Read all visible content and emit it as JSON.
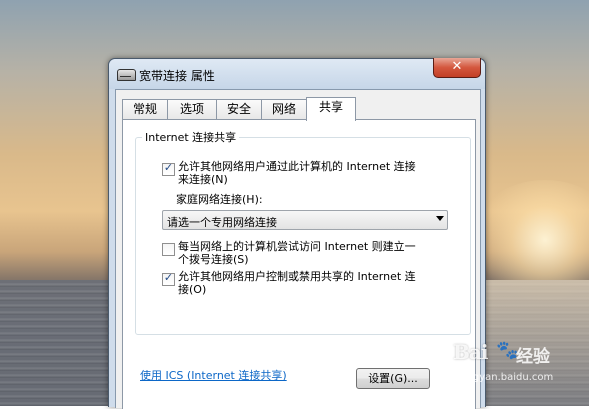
{
  "window": {
    "title": "宽带连接 属性",
    "close_label": "✕"
  },
  "tabs": [
    {
      "label": "常规",
      "active": false
    },
    {
      "label": "选项",
      "active": false
    },
    {
      "label": "安全",
      "active": false
    },
    {
      "label": "网络",
      "active": false
    },
    {
      "label": "共享",
      "active": true
    }
  ],
  "sharing": {
    "group_title": "Internet 连接共享",
    "allow_connect": {
      "checked": true,
      "line1": "允许其他网络用户通过此计算机的 Internet 连接",
      "line2": "来连接(N)"
    },
    "home_network_label": "家庭网络连接(H):",
    "home_network_select": "请选一个专用网络连接",
    "dial_on_demand": {
      "checked": false,
      "line1": "每当网络上的计算机尝试访问 Internet 则建立一",
      "line2": "个拨号连接(S)"
    },
    "allow_control": {
      "checked": true,
      "line1": "允许其他网络用户控制或禁用共享的 Internet 连",
      "line2": "接(O)"
    },
    "ics_link": "使用 ICS (Internet 连接共享)",
    "settings_button": "设置(G)..."
  },
  "watermark": {
    "brand": "Bai",
    "brand_suffix": "经验",
    "url": "jingyan.baidu.com"
  }
}
